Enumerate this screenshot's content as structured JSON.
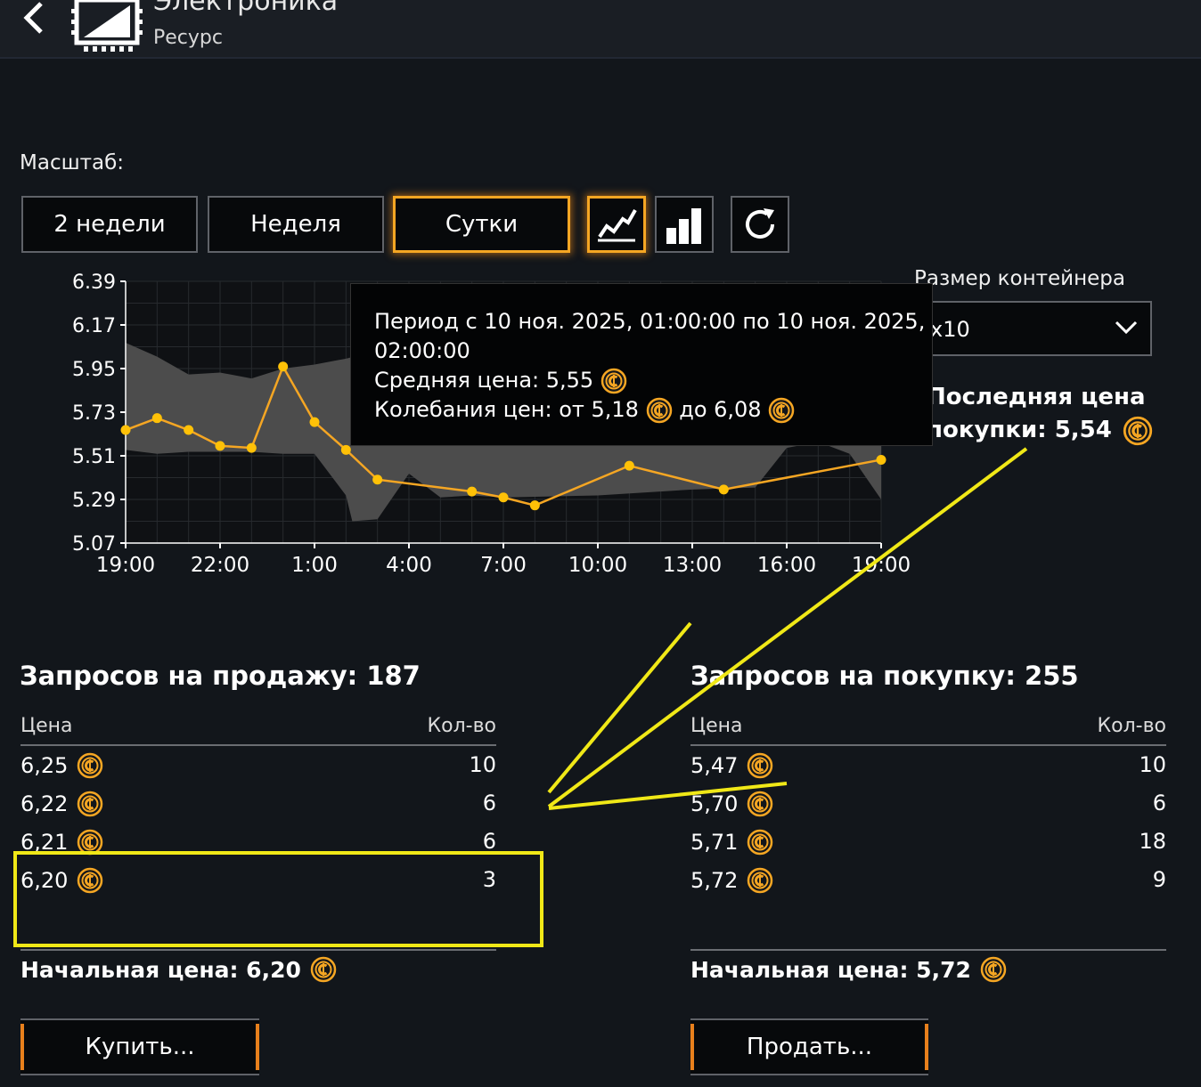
{
  "header": {
    "title": "Электроника",
    "subtitle": "Ресурс"
  },
  "scale": {
    "label": "Масштаб:",
    "buttons": [
      "2 недели",
      "Неделя",
      "Сутки"
    ],
    "active": "Сутки"
  },
  "container": {
    "label": "Размер контейнера",
    "value": "x10"
  },
  "last_price": {
    "line1": "Последняя цена",
    "line2": "покупки: 5,54"
  },
  "tooltip": {
    "line1": "Период с 10 ноя. 2025, 01:00:00 по 10 ноя. 2025,",
    "line2": "02:00:00",
    "avg": "Средняя цена: 5,55",
    "range_from": "Колебания цен: от 5,18",
    "range_to": "до 6,08"
  },
  "chart_data": {
    "type": "line",
    "y_ticks": [
      "6.39",
      "6.17",
      "5.95",
      "5.73",
      "5.51",
      "5.29",
      "5.07"
    ],
    "ylim": [
      5.07,
      6.39
    ],
    "x_ticks": [
      "19:00",
      "22:00",
      "1:00",
      "4:00",
      "7:00",
      "10:00",
      "13:00",
      "16:00",
      "19:00"
    ],
    "x_hours": [
      0,
      3,
      6,
      9,
      12,
      15,
      18,
      21,
      24
    ],
    "series": [
      {
        "type": "line",
        "color": "#f5a623",
        "points": [
          [
            0,
            5.64
          ],
          [
            1,
            5.7
          ],
          [
            2,
            5.64
          ],
          [
            3,
            5.56
          ],
          [
            4,
            5.55
          ],
          [
            5,
            5.96
          ],
          [
            6,
            5.68
          ],
          [
            7,
            5.54
          ],
          [
            8,
            5.39
          ],
          [
            11,
            5.33
          ],
          [
            12,
            5.3
          ],
          [
            13,
            5.26
          ],
          [
            16,
            5.46
          ],
          [
            19,
            5.34
          ],
          [
            24,
            5.49
          ]
        ]
      }
    ],
    "band": {
      "upper": [
        [
          0,
          6.08
        ],
        [
          1,
          6.01
        ],
        [
          2,
          5.92
        ],
        [
          3,
          5.93
        ],
        [
          4,
          5.9
        ],
        [
          5,
          5.95
        ],
        [
          6,
          5.97
        ],
        [
          7,
          6.0
        ],
        [
          7.5,
          6.02
        ],
        [
          24,
          6.02
        ]
      ],
      "lower": [
        [
          0,
          5.54
        ],
        [
          1,
          5.52
        ],
        [
          2,
          5.53
        ],
        [
          3,
          5.53
        ],
        [
          4,
          5.53
        ],
        [
          5,
          5.52
        ],
        [
          6,
          5.52
        ],
        [
          7,
          5.31
        ],
        [
          7.2,
          5.18
        ],
        [
          8,
          5.19
        ],
        [
          9,
          5.42
        ],
        [
          10,
          5.3
        ],
        [
          11,
          5.31
        ],
        [
          12,
          5.3
        ],
        [
          15,
          5.31
        ],
        [
          18,
          5.34
        ],
        [
          20,
          5.35
        ],
        [
          21,
          5.55
        ],
        [
          22,
          5.58
        ],
        [
          23,
          5.52
        ],
        [
          24,
          5.29
        ]
      ]
    }
  },
  "sell": {
    "title": "Запросов на продажу: 187",
    "col_price": "Цена",
    "col_qty": "Кол-во",
    "rows": [
      {
        "price": "6,25",
        "qty": "10"
      },
      {
        "price": "6,22",
        "qty": "6"
      },
      {
        "price": "6,21",
        "qty": "6"
      },
      {
        "price": "6,20",
        "qty": "3"
      }
    ],
    "start_price": "Начальная цена: 6,20",
    "button": "Купить..."
  },
  "buy": {
    "title": "Запросов на покупку: 255",
    "col_price": "Цена",
    "col_qty": "Кол-во",
    "rows": [
      {
        "price": "5,47",
        "qty": "10"
      },
      {
        "price": "5,70",
        "qty": "6"
      },
      {
        "price": "5,71",
        "qty": "18"
      },
      {
        "price": "5,72",
        "qty": "9"
      }
    ],
    "start_price": "Начальная цена: 5,72",
    "button": "Продать..."
  },
  "colors": {
    "accent": "#f5a623",
    "annotation": "#f0e817"
  }
}
